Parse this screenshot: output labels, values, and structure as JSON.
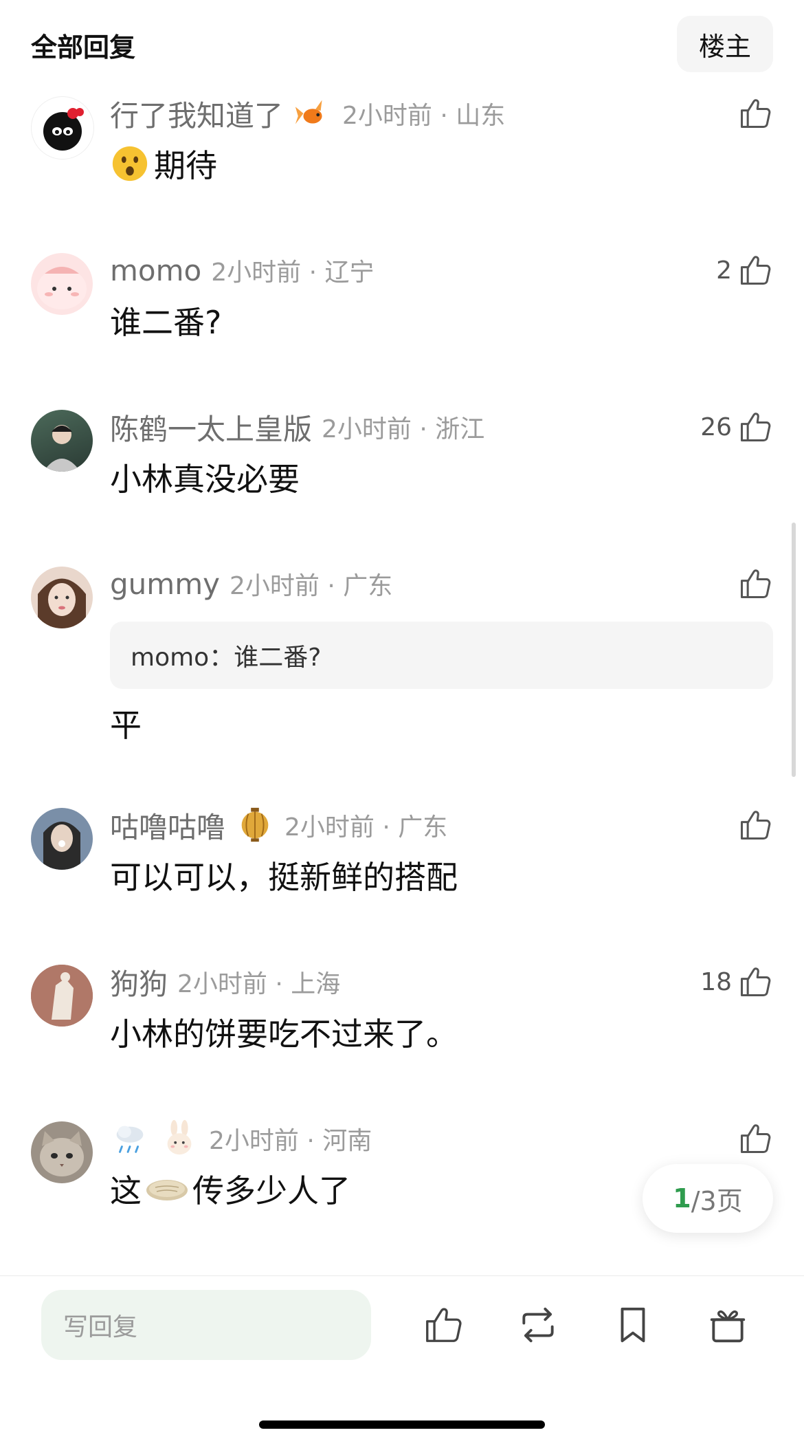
{
  "header": {
    "title": "全部回复",
    "floor_button": "楼主"
  },
  "comments": [
    {
      "username": "行了我知道了",
      "time_location": "2小时前 · 山东",
      "likes": "",
      "text": "期待"
    },
    {
      "username": "momo",
      "time_location": "2小时前 · 辽宁",
      "likes": "2",
      "text": "谁二番?"
    },
    {
      "username": "陈鹤一太上皇版",
      "time_location": "2小时前 · 浙江",
      "likes": "26",
      "text": "小林真没必要"
    },
    {
      "username": "gummy",
      "time_location": "2小时前 · 广东",
      "likes": "",
      "quote": "momo：谁二番?",
      "text": "平"
    },
    {
      "username": "咕噜咕噜",
      "time_location": "2小时前 · 广东",
      "likes": "",
      "text": "可以可以，挺新鲜的搭配"
    },
    {
      "username": "狗狗",
      "time_location": "2小时前 · 上海",
      "likes": "18",
      "text": "小林的饼要吃不过来了。"
    },
    {
      "username": "",
      "time_location": "2小时前 · 河南",
      "likes": "",
      "text_before": "这",
      "text_after": "传多少人了"
    }
  ],
  "pager": {
    "current": "1",
    "total": "/3页"
  },
  "bottom_bar": {
    "reply_placeholder": "写回复"
  },
  "icons": {
    "like": "thumbs-up-icon",
    "repost": "repost-icon",
    "bookmark": "bookmark-icon",
    "gift": "gift-icon",
    "badges": [
      "goldfish-icon",
      "lantern-icon",
      "rain-cloud-icon",
      "bunny-icon"
    ],
    "emojis": [
      "surprised-face-icon",
      "pancake-icon"
    ]
  },
  "colors": {
    "accent_green": "#2f9c4e",
    "input_bg": "#eef5ef",
    "muted_text": "#9b9b9b"
  }
}
